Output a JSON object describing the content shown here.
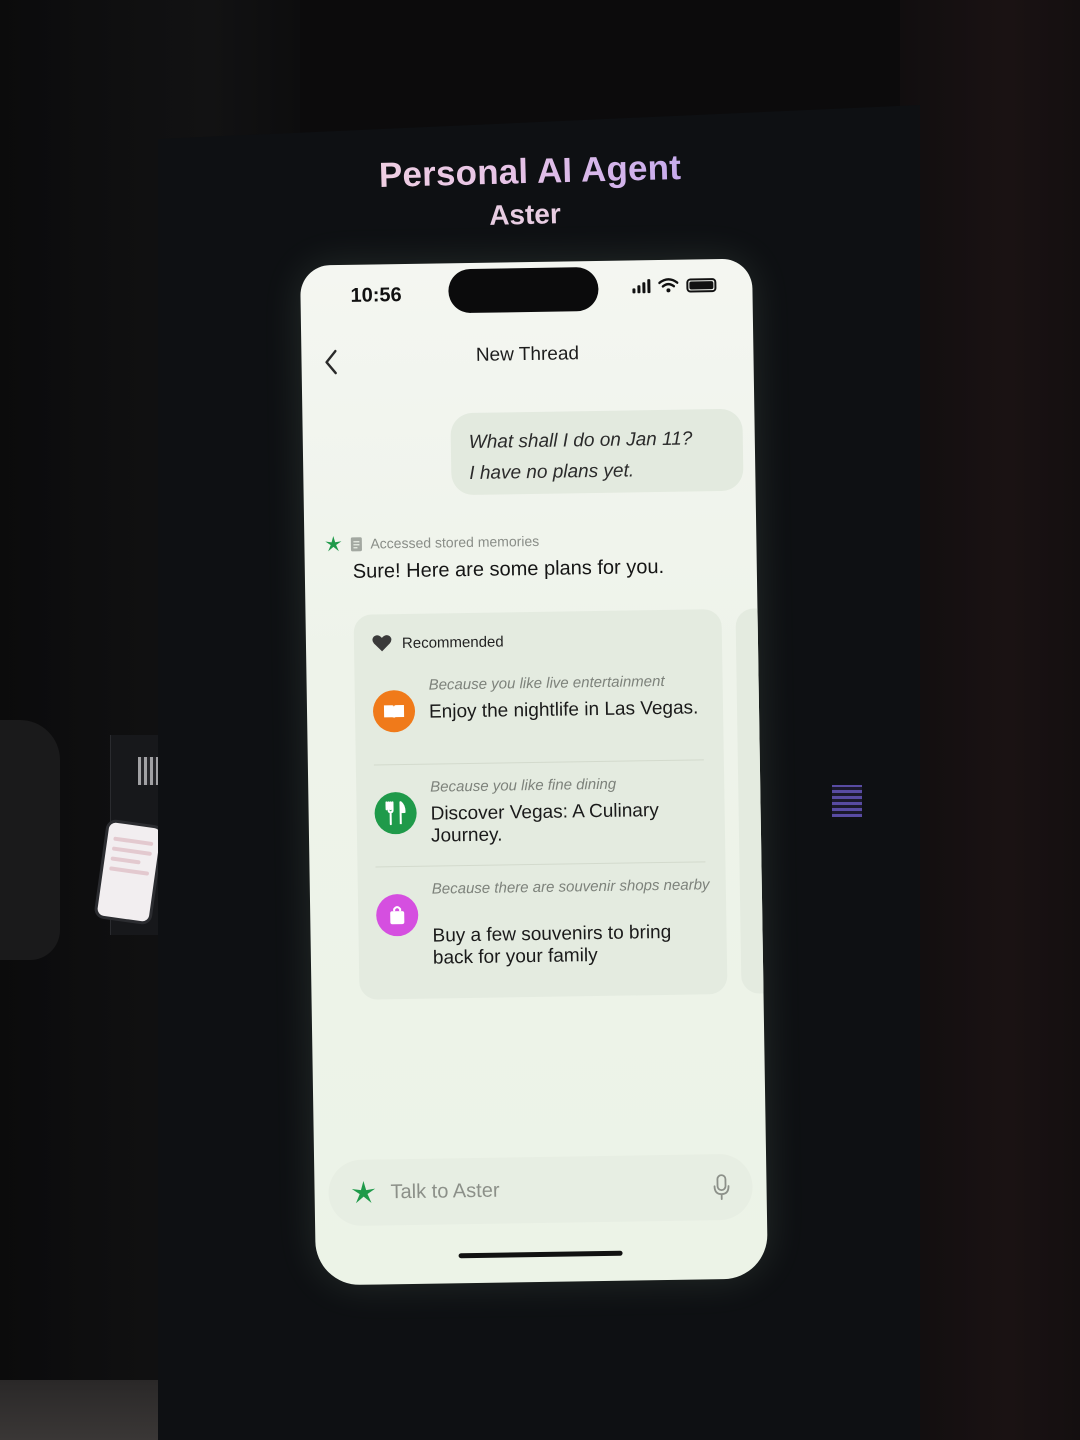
{
  "kiosk": {
    "title": "Personal AI Agent",
    "subtitle": "Aster"
  },
  "status_bar": {
    "time": "10:56",
    "icons": [
      "signal-icon",
      "wifi-icon",
      "battery-icon"
    ]
  },
  "nav": {
    "back_icon": "chevron-left-icon",
    "title": "New Thread"
  },
  "conversation": {
    "user_message": {
      "line1": "What shall I do on Jan 11?",
      "line2": "I have no plans yet."
    },
    "assistant": {
      "tool_status": "Accessed stored memories",
      "tool_icon": "note-icon",
      "avatar_icon": "aster-logo-icon",
      "reply": "Sure! Here are some plans for you."
    }
  },
  "recommendations": {
    "header": "Recommended",
    "header_icon": "heart-icon",
    "items": [
      {
        "reason": "Because you like live entertainment",
        "title": "Enjoy the nightlife in Las Vegas.",
        "icon": "ticket-icon",
        "color": "#f07a1a"
      },
      {
        "reason": "Because you like fine dining",
        "title": "Discover Vegas: A Culinary Journey.",
        "icon": "fork-knife-icon",
        "color": "#1f9a4a"
      },
      {
        "reason": "Because there are souvenir shops nearby",
        "title": "Buy a few souvenirs to bring back for your family",
        "icon": "shopping-bag-icon",
        "color": "#d54fe0"
      }
    ]
  },
  "input": {
    "placeholder": "Talk to Aster",
    "mic_icon": "microphone-icon"
  },
  "colors": {
    "kiosk_title_gradient": [
      "#f3d6e0",
      "#b9a0f0"
    ],
    "screen_background": "#eef3ea",
    "brand_green": "#1f9a4a"
  }
}
